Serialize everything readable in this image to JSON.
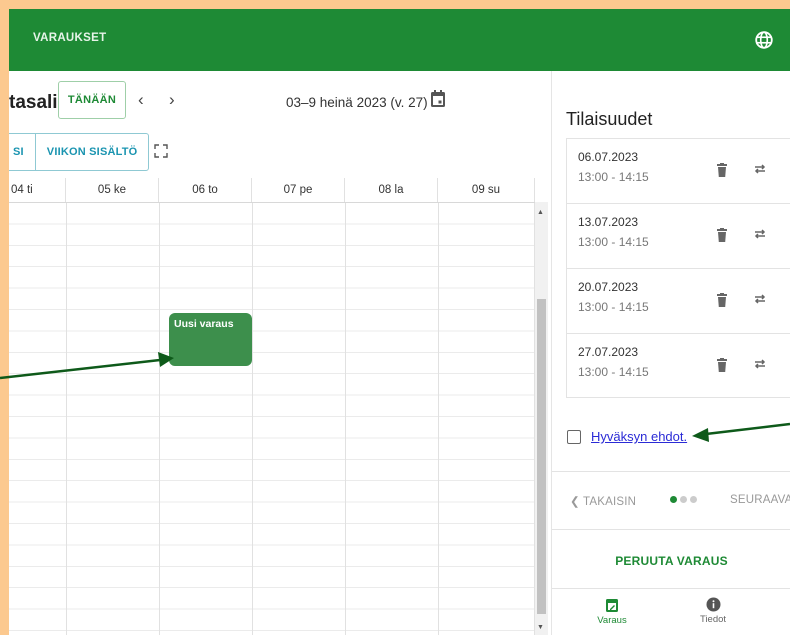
{
  "appbar": {
    "title": "VARAUKSET",
    "language_icon": "globe-icon"
  },
  "calendar": {
    "room_name": "tasali",
    "today_label": "TÄNÄÄN",
    "prev_icon": "chevron-left-icon",
    "next_icon": "chevron-right-icon",
    "date_range": "03–9 heinä 2023 (v. 27)",
    "calendar_icon": "calendar-icon",
    "views": [
      "SI",
      "VIIKON SISÄLTÖ"
    ],
    "fullscreen_icon": "fullscreen-icon",
    "days": [
      "04 ti",
      "05 ke",
      "06 to",
      "07 pe",
      "08 la",
      "09 su"
    ],
    "event_title": "Uusi varaus"
  },
  "occurrences": {
    "title": "Tilaisuudet",
    "items": [
      {
        "date": "06.07.2023",
        "time": "13:00 - 14:15"
      },
      {
        "date": "13.07.2023",
        "time": "13:00 - 14:15"
      },
      {
        "date": "20.07.2023",
        "time": "13:00 - 14:15"
      },
      {
        "date": "27.07.2023",
        "time": "13:00 - 14:15"
      }
    ]
  },
  "terms": {
    "label": "Hyväksyn ehdot.",
    "checked": false
  },
  "stepper": {
    "back": "TAKAISIN",
    "next": "SEURAAVA",
    "steps": 3,
    "active_step": 1
  },
  "cancel_label": "PERUUTA VARAUS",
  "bottom_nav": [
    {
      "label": "Varaus",
      "icon": "calendar-edit-icon",
      "active": true
    },
    {
      "label": "Tiedot",
      "icon": "info-icon",
      "active": false
    }
  ],
  "colors": {
    "primary": "#1e8a35",
    "event": "#3d8f4c",
    "outer_background": "#fcc98f",
    "link": "#2b2bd6"
  }
}
